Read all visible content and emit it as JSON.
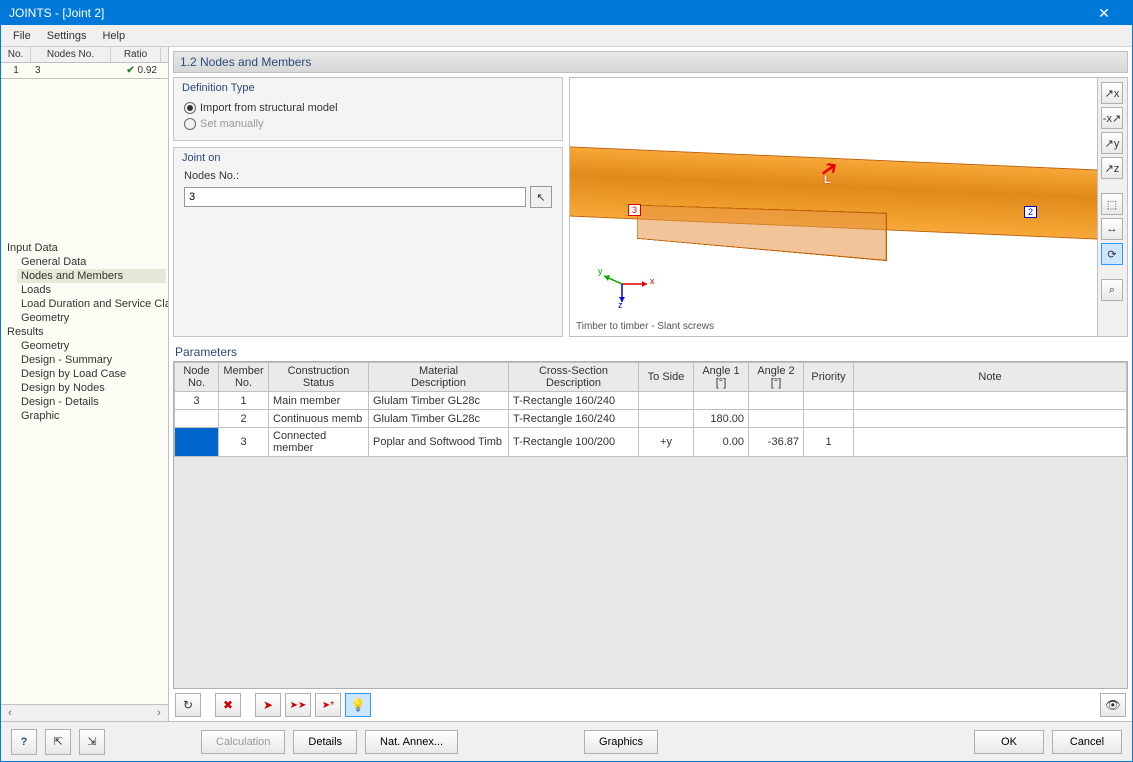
{
  "title": "JOINTS - [Joint 2]",
  "menu": {
    "file": "File",
    "settings": "Settings",
    "help": "Help"
  },
  "nav_table": {
    "headers": {
      "no": "No.",
      "nodes_no": "Nodes No.",
      "ratio": "Ratio"
    },
    "rows": [
      {
        "no": "1",
        "nodes_no": "3",
        "ratio": "0.92"
      }
    ]
  },
  "tree": {
    "input_data": "Input Data",
    "items_input": [
      "General Data",
      "Nodes and Members",
      "Loads",
      "Load Duration and Service Class",
      "Geometry"
    ],
    "results": "Results",
    "items_results": [
      "Geometry",
      "Design - Summary",
      "Design by Load Case",
      "Design by Nodes",
      "Design - Details",
      "Graphic"
    ]
  },
  "section": {
    "title": "1.2 Nodes and Members"
  },
  "definition": {
    "title": "Definition Type",
    "import": "Import from structural model",
    "manual": "Set manually"
  },
  "joint_on": {
    "title": "Joint on",
    "label": "Nodes No.:",
    "value": "3"
  },
  "viewport": {
    "caption": "Timber to timber - Slant screws",
    "node3": "3",
    "node2": "2",
    "l": "L",
    "axes": {
      "x": "x",
      "y": "y",
      "z": "z"
    }
  },
  "view_toolbar": {
    "iso_xz": "↗x",
    "neg_xz": "-x↗",
    "iso_yz": "↗y",
    "neg_yz": "↗z",
    "box": "⬚",
    "move": "↔",
    "rotate": "⟳",
    "zoom": "⌕"
  },
  "parameters": {
    "title": "Parameters",
    "headers": {
      "node_no": "Node No.",
      "member_no": "Member No.",
      "construction_status": "Construction Status",
      "material": "Material Description",
      "cross_section": "Cross-Section Description",
      "to_side": "To Side",
      "angle1": "Angle 1 [°]",
      "angle2": "Angle 2 [°]",
      "priority": "Priority",
      "note": "Note"
    },
    "rows": [
      {
        "node_no": "3",
        "member_no": "1",
        "status": "Main member",
        "material": "Glulam Timber GL28c",
        "cross": "T-Rectangle 160/240",
        "to_side": "",
        "angle1": "",
        "angle2": "",
        "priority": "",
        "note": ""
      },
      {
        "node_no": "",
        "member_no": "2",
        "status": "Continuous memb",
        "material": "Glulam Timber GL28c",
        "cross": "T-Rectangle 160/240",
        "to_side": "",
        "angle1": "180.00",
        "angle2": "",
        "priority": "",
        "note": ""
      },
      {
        "node_no": "",
        "member_no": "3",
        "status": "Connected member",
        "material": "Poplar and Softwood Timb",
        "cross": "T-Rectangle 100/200",
        "to_side": "+y",
        "angle1": "0.00",
        "angle2": "-36.87",
        "priority": "1",
        "note": ""
      }
    ]
  },
  "param_toolbar": {
    "refresh": "↻",
    "delete": "✖",
    "next": "➤",
    "next_all": "➤➤",
    "add": "➤*",
    "bulb": "💡",
    "eye": "👁"
  },
  "footer": {
    "help": "?",
    "export1": "⇱",
    "export2": "⇲",
    "calculation": "Calculation",
    "details": "Details",
    "nat_annex": "Nat. Annex...",
    "graphics": "Graphics",
    "ok": "OK",
    "cancel": "Cancel"
  }
}
